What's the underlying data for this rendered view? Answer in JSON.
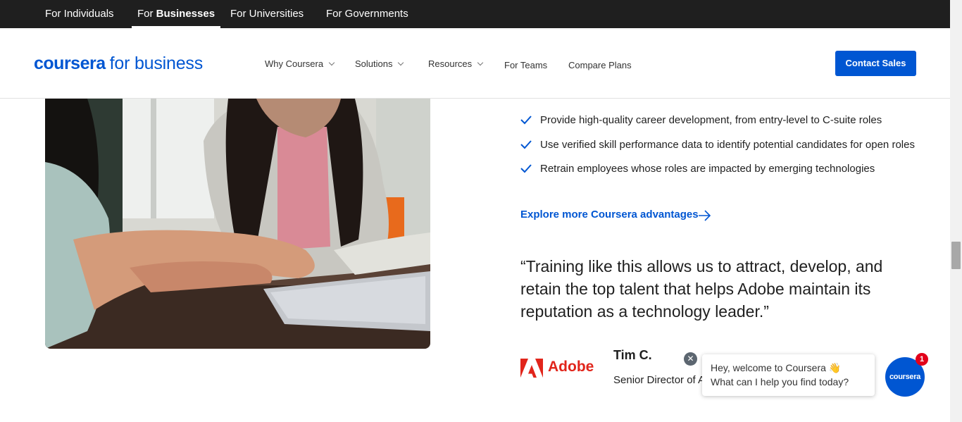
{
  "audience_tabs": [
    {
      "label": "For Individuals"
    },
    {
      "prefix": "For ",
      "bold": "Businesses",
      "active": true
    },
    {
      "label": "For Universities"
    },
    {
      "label": "For Governments"
    }
  ],
  "header": {
    "logo_brand": "coursera",
    "logo_suffix": "for business",
    "nav": [
      {
        "label": "Why Coursera",
        "dropdown": true
      },
      {
        "label": "Solutions",
        "dropdown": true
      },
      {
        "label": "Resources",
        "dropdown": true
      },
      {
        "label": "For Teams",
        "dropdown": false
      },
      {
        "label": "Compare Plans",
        "dropdown": false
      }
    ],
    "contact_label": "Contact Sales"
  },
  "content": {
    "benefits": [
      "Provide high-quality career development, from entry-level to C-suite roles",
      "Use verified skill performance data to identify potential candidates for open roles",
      "Retrain employees whose roles are impacted by emerging technologies"
    ],
    "explore_label": "Explore more Coursera advantages",
    "quote": "“Training like this allows us to attract, develop, and retain the top talent that helps Adobe maintain its reputation as a technology leader.”",
    "company": "Adobe",
    "person_name": "Tim C.",
    "person_title": "Senior Director of A"
  },
  "chat": {
    "line1": "Hey, welcome to Coursera 👋",
    "line2": "What can I help you find today?",
    "launcher_label": "coursera",
    "badge": "1",
    "close_glyph": "✕"
  },
  "colors": {
    "brand_blue": "#0056d2",
    "top_bar": "#1f1f1f",
    "adobe_red": "#e1251b",
    "badge_red": "#e2001a"
  }
}
